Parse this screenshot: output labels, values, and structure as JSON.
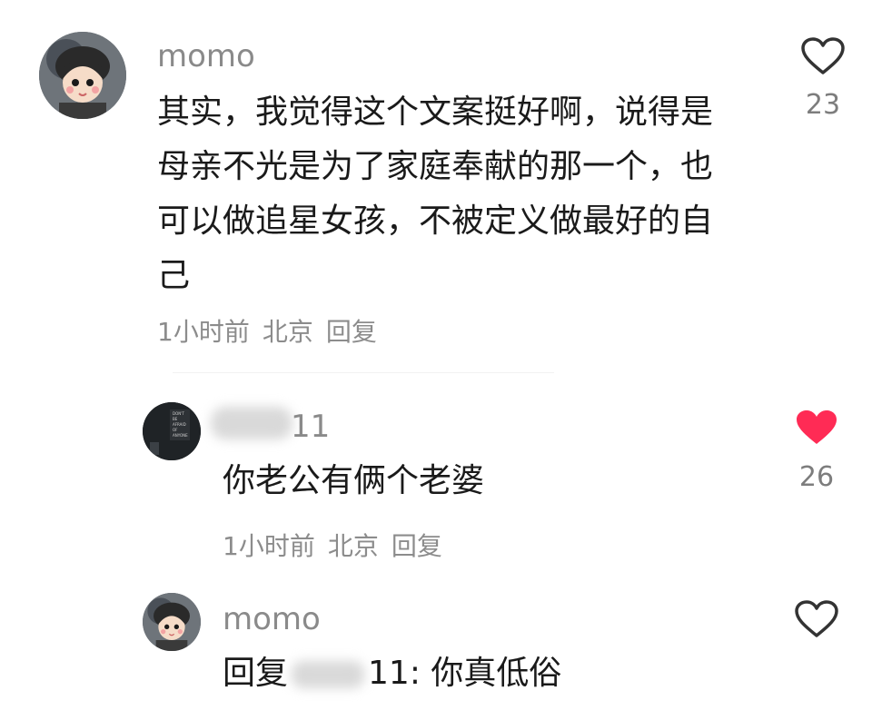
{
  "comments": [
    {
      "username": "momo",
      "text_lines": [
        "其实，我觉得这个文案挺好啊，说得是",
        "母亲不光是为了家庭奉献的那一个，也",
        "可以做追星女孩，不被定义做最好的自",
        "己"
      ],
      "time": "1小时前",
      "location": "北京",
      "reply_label": "回复",
      "likes": "23",
      "liked": false
    },
    {
      "username_suffix": "11",
      "avatar_text": "DON'T BE AFRAID OF ANYONE",
      "text": "你老公有俩个老婆",
      "time": "1小时前",
      "location": "北京",
      "reply_label": "回复",
      "likes": "26",
      "liked": true
    },
    {
      "username": "momo",
      "text_prefix": "回复",
      "text_suffix": "11: 你真低俗",
      "liked": false
    }
  ],
  "colors": {
    "liked": "#ff2b55",
    "icon_outline": "#333333",
    "meta": "#8c8c8c"
  }
}
